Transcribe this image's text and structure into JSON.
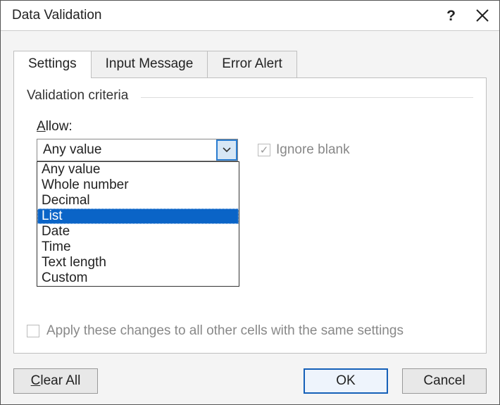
{
  "window": {
    "title": "Data Validation"
  },
  "tabs": [
    {
      "label": "Settings",
      "active": true
    },
    {
      "label": "Input Message",
      "active": false
    },
    {
      "label": "Error Alert",
      "active": false
    }
  ],
  "group": {
    "title": "Validation criteria"
  },
  "allow": {
    "label_prefix": "A",
    "label_rest": "llow:",
    "selected": "Any value",
    "options": [
      "Any value",
      "Whole number",
      "Decimal",
      "List",
      "Date",
      "Time",
      "Text length",
      "Custom"
    ],
    "highlighted_index": 3
  },
  "ignore_blank": {
    "label": "Ignore blank",
    "checked": true,
    "enabled": false
  },
  "apply_all": {
    "label": "Apply these changes to all other cells with the same settings",
    "checked": false,
    "enabled": false
  },
  "buttons": {
    "clear_all_prefix": "C",
    "clear_all_rest": "lear All",
    "ok": "OK",
    "cancel": "Cancel"
  }
}
